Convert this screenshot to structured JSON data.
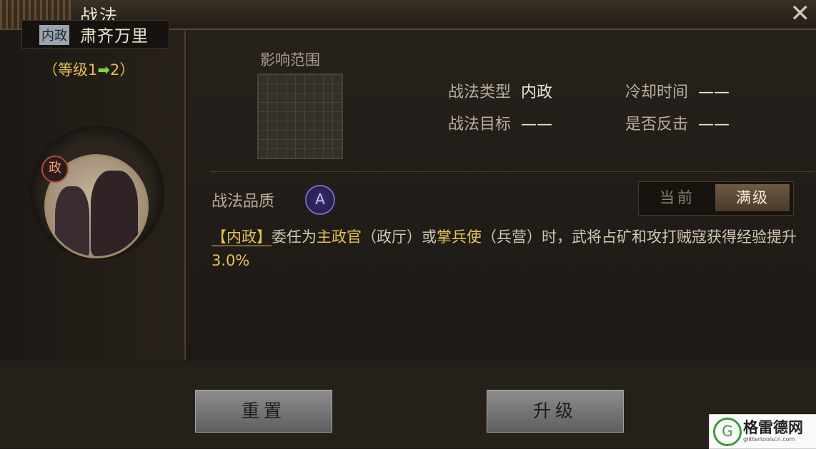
{
  "window": {
    "title": "战法",
    "close_glyph": "✕"
  },
  "skill": {
    "domain_badge": "内政",
    "name": "肃齐万里",
    "level_prefix": "（等级1",
    "level_arrow": "➡",
    "level_suffix": "2）",
    "portrait_badge": "政"
  },
  "range": {
    "label": "影响范围"
  },
  "attributes": [
    {
      "key": "战法类型",
      "value": "内政"
    },
    {
      "key": "冷却时间",
      "value": "——"
    },
    {
      "key": "战法目标",
      "value": "——"
    },
    {
      "key": "是否反击",
      "value": "——"
    }
  ],
  "quality": {
    "label": "战法品质",
    "grade": "A"
  },
  "toggle": {
    "current": "当前",
    "max": "满级",
    "selected": "满级"
  },
  "description": {
    "tag": "【内政】",
    "part1": "委任为",
    "role1": "主政官",
    "part2": "（政厅）或",
    "role2": "掌兵使",
    "part3": "（兵营）时，武将占矿和攻打贼寇获得经验提升",
    "value": "3.0%"
  },
  "buttons": {
    "reset": "重置",
    "upgrade": "升级"
  },
  "watermark": {
    "name": "格雷德网",
    "url": "glittertoolscn.com",
    "logo": "G"
  },
  "colors": {
    "accent_gold": "#e6c35a",
    "level_arrow": "#7fd33b",
    "quality_purple": "#7a64c8"
  }
}
